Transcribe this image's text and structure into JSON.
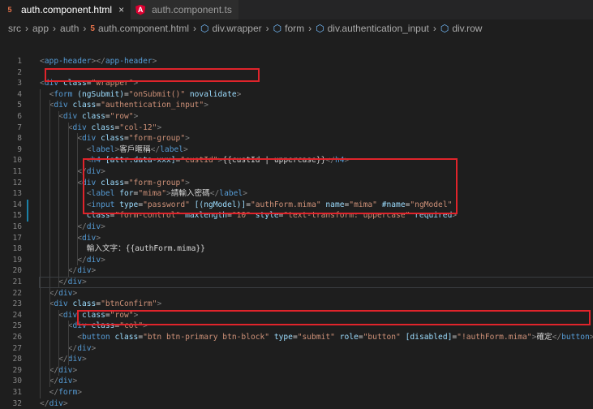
{
  "tabs": [
    {
      "label": "auth.component.html",
      "icon": "html5-icon",
      "close": "×"
    },
    {
      "label": "auth.component.ts",
      "icon": "angular-icon"
    }
  ],
  "breadcrumb": [
    "src",
    "app",
    "auth",
    "auth.component.html",
    "div.wrapper",
    "form",
    "div.authentication_input",
    "div.row"
  ],
  "lines": [
    {
      "n": "1",
      "html": "<span class='punc'>&lt;</span><span class='tag'>app-header</span><span class='punc'>&gt;&lt;/</span><span class='tag'>app-header</span><span class='punc'>&gt;</span>"
    },
    {
      "n": "2",
      "html": ""
    },
    {
      "n": "3",
      "html": "<span class='punc'>&lt;</span><span class='tag'>div</span> <span class='attr'>class</span>=<span class='str'>\"wrapper\"</span><span class='punc'>&gt;</span>"
    },
    {
      "n": "4",
      "html": "  <span class='punc'>&lt;</span><span class='tag'>form</span> <span class='attr'>(ngSubmit)</span>=<span class='str'>\"onSubmit()\"</span> <span class='attr'>novalidate</span><span class='punc'>&gt;</span>"
    },
    {
      "n": "5",
      "html": "  <span class='punc'>&lt;</span><span class='tag'>div</span> <span class='attr'>class</span>=<span class='str'>\"authentication_input\"</span><span class='punc'>&gt;</span>"
    },
    {
      "n": "6",
      "html": "    <span class='punc'>&lt;</span><span class='tag'>div</span> <span class='attr'>class</span>=<span class='str'>\"row\"</span><span class='punc'>&gt;</span>"
    },
    {
      "n": "7",
      "html": "      <span class='punc'>&lt;</span><span class='tag'>div</span> <span class='attr'>class</span>=<span class='str'>\"col-12\"</span><span class='punc'>&gt;</span>"
    },
    {
      "n": "8",
      "html": "        <span class='punc'>&lt;</span><span class='tag'>div</span> <span class='attr'>class</span>=<span class='str'>\"form-group\"</span><span class='punc'>&gt;</span>"
    },
    {
      "n": "9",
      "html": "          <span class='punc'>&lt;</span><span class='tag'>label</span><span class='punc'>&gt;</span><span class='txt'>客戶暱稱</span><span class='punc'>&lt;/</span><span class='tag'>label</span><span class='punc'>&gt;</span>"
    },
    {
      "n": "10",
      "html": "          <span class='punc'>&lt;</span><span class='tag'>h4</span> <span class='attr'>[attr.data-xxx]</span>=<span class='str'>\"custId\"</span><span class='punc'>&gt;</span><span class='txt'>{{custId | uppercase}}</span><span class='punc'>&lt;/</span><span class='tag'>h4</span><span class='punc'>&gt;</span>"
    },
    {
      "n": "11",
      "html": "        <span class='punc'>&lt;/</span><span class='tag'>div</span><span class='punc'>&gt;</span>"
    },
    {
      "n": "12",
      "html": "        <span class='punc'>&lt;</span><span class='tag'>div</span> <span class='attr'>class</span>=<span class='str'>\"form-group\"</span><span class='punc'>&gt;</span>"
    },
    {
      "n": "13",
      "html": "          <span class='punc'>&lt;</span><span class='tag'>label</span> <span class='attr'>for</span>=<span class='str'>\"mima\"</span><span class='punc'>&gt;</span><span class='txt'>請輸入密碼</span><span class='punc'>&lt;/</span><span class='tag'>label</span><span class='punc'>&gt;</span>"
    },
    {
      "n": "14",
      "html": "          <span class='punc'>&lt;</span><span class='tag'>input</span> <span class='attr'>type</span>=<span class='str'>\"password\"</span> <span class='attr'>[(ngModel)]</span>=<span class='str'>\"authForm.mima\"</span> <span class='attr'>name</span>=<span class='str'>\"mima\"</span> <span class='attr'>#name</span>=<span class='str'>\"ngModel\"</span>"
    },
    {
      "n": "15",
      "html": "          <span class='attr'>class</span>=<span class='str'>\"form-control\"</span> <span class='attr'>maxlength</span>=<span class='str'>\"10\"</span> <span class='attr'>style</span>=<span class='str'>\"text-transform: uppercase\"</span> <span class='attr'>required</span><span class='punc'>&gt;</span>"
    },
    {
      "n": "16",
      "html": "        <span class='punc'>&lt;/</span><span class='tag'>div</span><span class='punc'>&gt;</span>"
    },
    {
      "n": "17",
      "html": "        <span class='punc'>&lt;</span><span class='tag'>div</span><span class='punc'>&gt;</span>"
    },
    {
      "n": "18",
      "html": "          <span class='txt'>輸入文字：{{authForm.mima}}</span>"
    },
    {
      "n": "19",
      "html": "        <span class='punc'>&lt;/</span><span class='tag'>div</span><span class='punc'>&gt;</span>"
    },
    {
      "n": "20",
      "html": "      <span class='punc'>&lt;/</span><span class='tag'>div</span><span class='punc'>&gt;</span>"
    },
    {
      "n": "21",
      "html": "    <span class='punc'>&lt;/</span><span class='tag'>div</span><span class='punc'>&gt;</span>"
    },
    {
      "n": "22",
      "html": "  <span class='punc'>&lt;/</span><span class='tag'>div</span><span class='punc'>&gt;</span>"
    },
    {
      "n": "23",
      "html": "  <span class='punc'>&lt;</span><span class='tag'>div</span> <span class='attr'>class</span>=<span class='str'>\"btnConfirm\"</span><span class='punc'>&gt;</span>"
    },
    {
      "n": "24",
      "html": "    <span class='punc'>&lt;</span><span class='tag'>div</span> <span class='attr'>class</span>=<span class='str'>\"row\"</span><span class='punc'>&gt;</span>"
    },
    {
      "n": "25",
      "html": "      <span class='punc'>&lt;</span><span class='tag'>div</span> <span class='attr'>class</span>=<span class='str'>\"col\"</span><span class='punc'>&gt;</span>"
    },
    {
      "n": "26",
      "html": "        <span class='punc'>&lt;</span><span class='tag'>button</span> <span class='attr'>class</span>=<span class='str'>\"btn btn-primary btn-block\"</span> <span class='attr'>type</span>=<span class='str'>\"submit\"</span> <span class='attr'>role</span>=<span class='str'>\"button\"</span> <span class='attr'>[disabled]</span>=<span class='str'>\"!authForm.mima\"</span><span class='punc'>&gt;</span><span class='txt'>確定</span><span class='punc'>&lt;/</span><span class='tag'>button</span><span class='punc'>&gt;</span>"
    },
    {
      "n": "27",
      "html": "      <span class='punc'>&lt;/</span><span class='tag'>div</span><span class='punc'>&gt;</span>"
    },
    {
      "n": "28",
      "html": "    <span class='punc'>&lt;/</span><span class='tag'>div</span><span class='punc'>&gt;</span>"
    },
    {
      "n": "29",
      "html": "  <span class='punc'>&lt;/</span><span class='tag'>div</span><span class='punc'>&gt;</span>"
    },
    {
      "n": "30",
      "html": "  <span class='punc'>&lt;/</span><span class='tag'>div</span><span class='punc'>&gt;</span>"
    },
    {
      "n": "31",
      "html": "  <span class='punc'>&lt;/</span><span class='tag'>form</span><span class='punc'>&gt;</span>"
    },
    {
      "n": "32",
      "html": "<span class='punc'>&lt;/</span><span class='tag'>div</span><span class='punc'>&gt;</span>"
    }
  ],
  "colors": {
    "tag": "#569cd6",
    "attr": "#9cdcfe",
    "string": "#ce9178",
    "highlight_box": "#e0242b",
    "background": "#1e1e1e"
  }
}
